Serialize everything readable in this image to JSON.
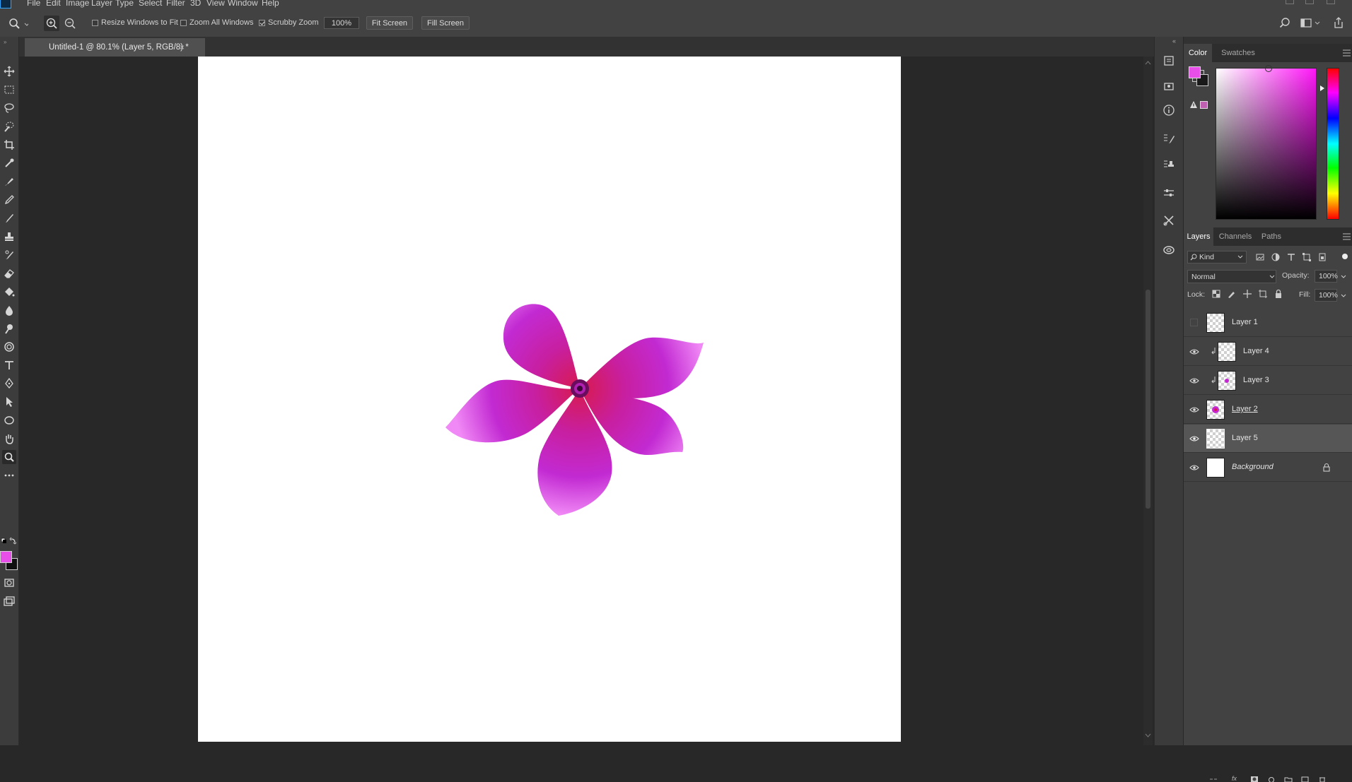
{
  "menubar": {
    "items": [
      "File",
      "Edit",
      "Image",
      "Layer",
      "Type",
      "Select",
      "Filter",
      "3D",
      "View",
      "Window",
      "Help"
    ]
  },
  "options_bar": {
    "resize_windows_label": "Resize Windows to Fit",
    "resize_windows_checked": false,
    "zoom_all_label": "Zoom All Windows",
    "zoom_all_checked": false,
    "scrubby_label": "Scrubby Zoom",
    "scrubby_checked": true,
    "zoom_value": "100%",
    "fit_screen_label": "Fit Screen",
    "fill_screen_label": "Fill Screen"
  },
  "document": {
    "tab_title": "Untitled-1 @ 80.1% (Layer 5, RGB/8) *",
    "close_glyph": "×"
  },
  "color_panel": {
    "tabs": [
      "Color",
      "Swatches"
    ],
    "active_tab": "Color",
    "foreground": "#e84fe8",
    "background": "#1a1a1a",
    "gamut_swatch": "#c060b0"
  },
  "layers_panel": {
    "tabs": [
      "Layers",
      "Channels",
      "Paths"
    ],
    "active_tab": "Layers",
    "filter_kind": "Kind",
    "blend_mode": "Normal",
    "opacity_label": "Opacity:",
    "opacity_value": "100%",
    "lock_label": "Lock:",
    "fill_label": "Fill:",
    "fill_value": "100%",
    "layers": [
      {
        "name": "Layer 1",
        "visible": false,
        "clipped": false,
        "italic": false,
        "underline": false,
        "selected": false
      },
      {
        "name": "Layer 4",
        "visible": true,
        "clipped": true,
        "italic": false,
        "underline": false,
        "selected": false
      },
      {
        "name": "Layer 3",
        "visible": true,
        "clipped": true,
        "italic": false,
        "underline": false,
        "selected": false
      },
      {
        "name": "Layer 2",
        "visible": true,
        "clipped": false,
        "italic": false,
        "underline": true,
        "selected": false
      },
      {
        "name": "Layer 5",
        "visible": true,
        "clipped": false,
        "italic": false,
        "underline": false,
        "selected": true
      },
      {
        "name": "Background",
        "visible": true,
        "clipped": false,
        "italic": true,
        "underline": false,
        "selected": false,
        "locked": true
      }
    ]
  },
  "colors": {
    "petal": "#c428d0",
    "petal_light": "#ef80f5",
    "center": "#d81a4e"
  }
}
